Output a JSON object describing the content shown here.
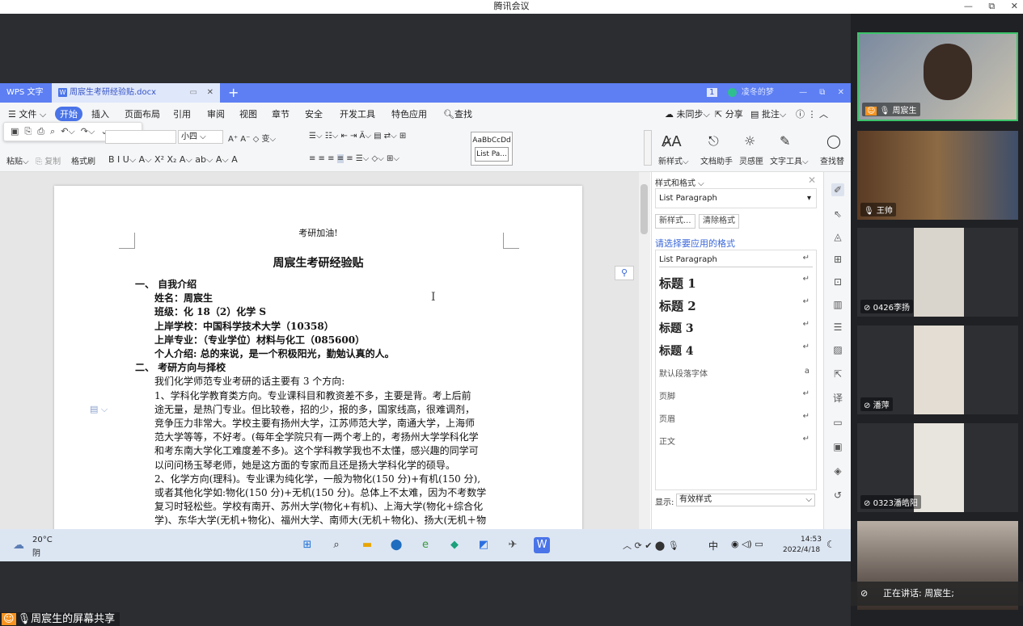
{
  "window": {
    "title": "腾讯会议",
    "controls": [
      "—",
      "⧉",
      "✕"
    ]
  },
  "wps": {
    "tabs": {
      "app": "WPS 文字",
      "doc": "周宸生考研经验贴.docx",
      "user": "凌冬的梦"
    },
    "menu": [
      "文件",
      "开始",
      "插入",
      "页面布局",
      "引用",
      "审阅",
      "视图",
      "章节",
      "安全",
      "开发工具",
      "特色应用",
      "查找"
    ],
    "menu_right": [
      "未同步",
      "分享",
      "批注"
    ],
    "ribbon": {
      "paste": "粘贴",
      "copy": "复制",
      "format_painter": "格式刷",
      "font_size": "小四",
      "style_preview": "AaBbCcDd",
      "style_name": "List Pa...",
      "new_style": "新样式",
      "doc_helper": "文档助手",
      "inspiration": "灵感匣",
      "text_tools": "文字工具",
      "find_replace": "查找替"
    },
    "document": {
      "header": "考研加油!",
      "title": "周宸生考研经验贴",
      "lines": [
        {
          "t": "一、      自我介绍",
          "b": true
        },
        {
          "t": "姓名：周宸生",
          "b": true
        },
        {
          "t": "班级：化 18（2）化学 S",
          "b": true
        },
        {
          "t": "上岸学校：中国科学技术大学（10358）",
          "b": true
        },
        {
          "t": "上岸专业：（专业学位）材料与化工（085600）",
          "b": true
        },
        {
          "t": "个人介绍: 总的来说，是一个积极阳光，勤勉认真的人。",
          "b": true
        },
        {
          "t": "二、      考研方向与择校",
          "b": true
        },
        {
          "t": "我们化学师范专业考研的话主要有 3 个方向:",
          "b": false
        },
        {
          "t": "1、学科化学教育类方向。专业课科目和教资差不多，主要是背。考上后前",
          "b": false
        },
        {
          "t": "途无量，是热门专业。但比较卷，招的少，报的多，国家线高，很难调剂，",
          "b": false
        },
        {
          "t": "竞争压力非常大。学校主要有扬州大学，江苏师范大学，南通大学，上海师",
          "b": false
        },
        {
          "t": "范大学等等，不好考。(每年全学院只有一两个考上的，考扬州大学学科化学",
          "b": false
        },
        {
          "t": "和考东南大学化工难度差不多)。这个学科教学我也不太懂，感兴趣的同学可",
          "b": false
        },
        {
          "t": "以问问杨玉琴老师，她是这方面的专家而且还是扬大学科化学的硕导。",
          "b": false
        },
        {
          "t": "2、化学方向(理科)。专业课为纯化学，一般为物化(150 分)+有机(150 分),",
          "b": false
        },
        {
          "t": "或者其他化学如:物化(150 分)+无机(150 分)。总体上不太难，因为不考数学",
          "b": false
        },
        {
          "t": "复习时轻松些。学校有南开、苏州大学(物化+有机)、上海大学(物化+综合化",
          "b": false
        },
        {
          "t": "学)、东华大学(无机+物化)、福州大学、南师大(无机＋物化)、扬大(无机＋物",
          "b": false
        }
      ]
    },
    "sidebar": {
      "title": "样式和格式",
      "current_style": "List Paragraph",
      "new_style_btn": "新样式...",
      "clear_btn": "清除格式",
      "choose_label": "请选择要应用的格式",
      "styles": [
        "List Paragraph",
        "标题 1",
        "标题 2",
        "标题 3",
        "标题 4",
        "默认段落字体",
        "页脚",
        "页眉",
        "正文"
      ],
      "show_label": "显示:",
      "show_value": "有效样式"
    }
  },
  "taskbar": {
    "weather_temp": "20°C",
    "weather_desc": "阴",
    "ime": "中",
    "time": "14:53",
    "date": "2022/4/18"
  },
  "share_label": "周宸生的屏幕共享",
  "participants": [
    {
      "name": "周宸生"
    },
    {
      "name": "王帅"
    },
    {
      "name": "0426李扬"
    },
    {
      "name": "潘萍"
    },
    {
      "name": "0323潘皓阳"
    }
  ],
  "speaking": "正在讲话: 周宸生;"
}
